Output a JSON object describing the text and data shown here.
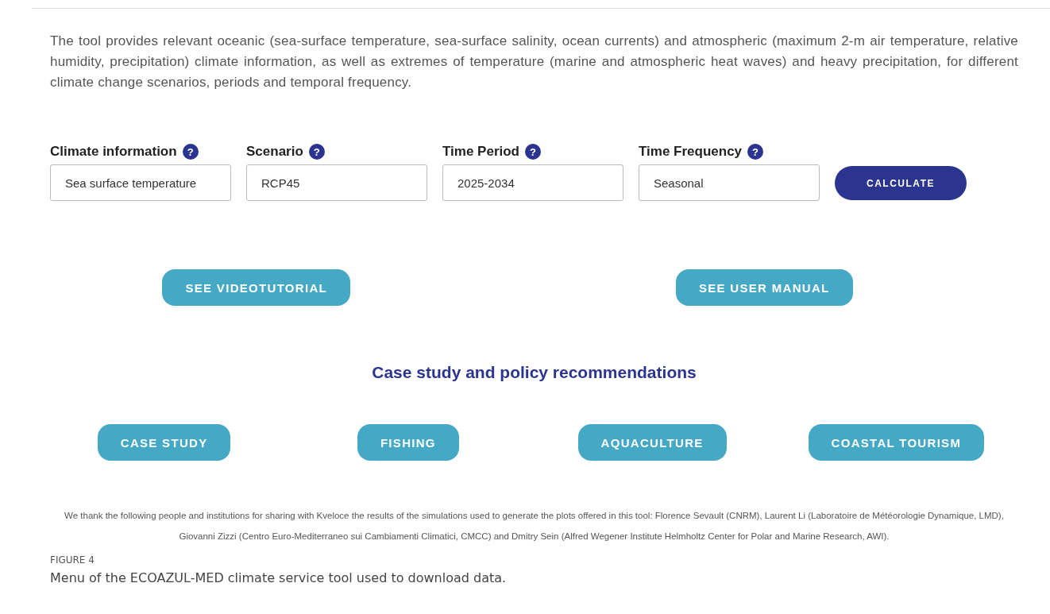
{
  "intro": "The tool provides relevant oceanic (sea-surface temperature, sea-surface salinity, ocean currents) and atmospheric (maximum 2-m air temperature, relative humidity, precipitation) climate information, as well as extremes of temperature (marine and atmospheric heat waves) and heavy precipitation, for different climate change scenarios, periods and temporal frequency.",
  "fields": [
    {
      "label": "Climate information",
      "help": "?",
      "value": "Sea surface temperature"
    },
    {
      "label": "Scenario",
      "help": "?",
      "value": "RCP45"
    },
    {
      "label": "Time Period",
      "help": "?",
      "value": "2025-2034"
    },
    {
      "label": "Time Frequency",
      "help": "?",
      "value": "Seasonal"
    }
  ],
  "calculate_button": "CALCULATE",
  "resource_buttons": [
    "SEE VIDEOTUTORIAL",
    "SEE USER MANUAL"
  ],
  "section_heading": "Case study and policy recommendations",
  "case_buttons": [
    "CASE STUDY",
    "FISHING",
    "AQUACULTURE",
    "COASTAL TOURISM"
  ],
  "credits": "We thank the following people and institutions for sharing with Kveloce the results of the simulations used to generate the plots offered in this tool: Florence Sevault (CNRM), Laurent Li (Laboratoire de Météorologie Dynamique, LMD), Giovanni Zizzi (Centro Euro-Mediterraneo sui Cambiamenti Climatici, CMCC) and Dmitry Sein (Alfred Wegener Institute Helmholtz Center for Polar and Marine Research, AWI).",
  "figure": {
    "label": "FIGURE 4",
    "caption": "Menu of the ECOAZUL-MED climate service tool used to download data."
  }
}
